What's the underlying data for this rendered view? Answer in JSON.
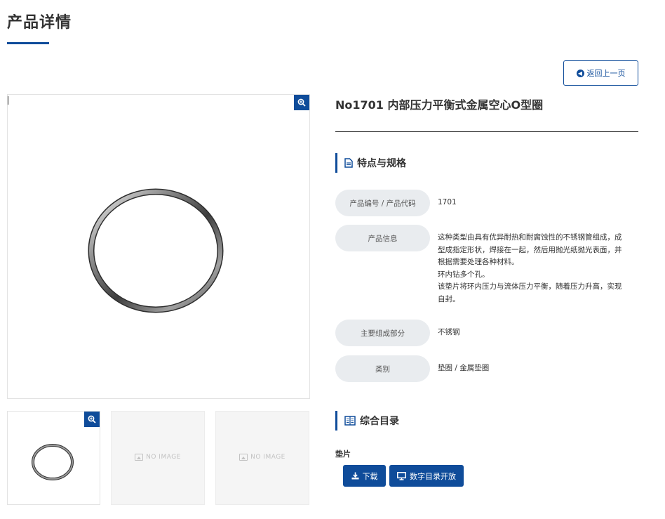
{
  "page": {
    "title": "产品详情",
    "back_label": "返回上一页"
  },
  "product": {
    "title": "No1701 内部压力平衡式金属空心O型圈",
    "main_image_icon": "metal-o-ring",
    "thumbnails": [
      {
        "type": "image",
        "icon": "metal-o-ring"
      },
      {
        "type": "placeholder",
        "text": "NO IMAGE"
      },
      {
        "type": "placeholder",
        "text": "NO IMAGE"
      }
    ]
  },
  "specs": {
    "heading": "特点与规格",
    "rows": [
      {
        "label": "产品编号 / 产品代码",
        "value": "1701"
      },
      {
        "label": "产品信息",
        "lines": [
          "这种类型由具有优异耐热和耐腐蚀性的不锈钢管组成，成",
          "型成指定形状，焊接在一起，然后用抛光纸抛光表面，并",
          "根据需要处理各种材料。",
          "环内钻多个孔。",
          "该垫片将环内压力与流体压力平衡，随着压力升高，实现",
          "自封。"
        ]
      },
      {
        "label": "主要组成部分",
        "value": "不锈钢"
      },
      {
        "label": "类别",
        "value": "垫圈 / 金属垫圈"
      }
    ]
  },
  "catalog": {
    "heading": "综合目录",
    "label": "垫片",
    "download_label": "下载",
    "ecatalog_label": "数字目录开放"
  },
  "colors": {
    "accent": "#0f4c9a",
    "label_bg": "#e9ecef",
    "text": "#333333"
  }
}
